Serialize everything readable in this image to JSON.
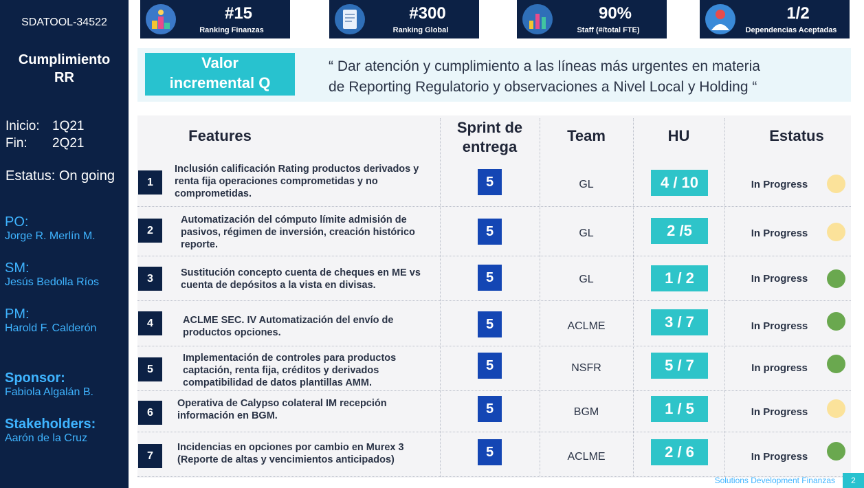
{
  "sidebar": {
    "id": "SDATOOL-34522",
    "title_line1": "Cumplimiento",
    "title_line2": "RR",
    "inicio_label": "Inicio:",
    "inicio_value": "1Q21",
    "fin_label": "Fin:",
    "fin_value": "2Q21",
    "estatus": "Estatus: On going",
    "po_label": "PO:",
    "po_name": "Jorge R. Merlín M.",
    "sm_label": "SM:",
    "sm_name": "Jesús Bedolla Ríos",
    "pm_label": "PM:",
    "pm_name": "Harold F. Calderón",
    "sponsor_label": "Sponsor:",
    "sponsor_name": "Fabiola Algalán B.",
    "stakeholders_label": "Stakeholders:",
    "stakeholders_name": "Aarón de la Cruz"
  },
  "kpis": [
    {
      "value": "#15",
      "label": "Ranking Finanzas",
      "icon": "podium-icon"
    },
    {
      "value": "#300",
      "label": "Ranking Global",
      "icon": "document-icon"
    },
    {
      "value": "90%",
      "label": "Staff (#/total FTE)",
      "icon": "bar-chart-icon"
    },
    {
      "value": "1/2",
      "label": "Dependencias Aceptadas",
      "icon": "person-icon"
    }
  ],
  "value_box": {
    "line1": "Valor",
    "line2": "incremental Q"
  },
  "quote": {
    "line1": "“ Dar atención y cumplimiento a las líneas más urgentes en materia",
    "line2": "de Reporting Regulatorio y observaciones a Nivel Local y Holding “"
  },
  "table": {
    "headers": {
      "features": "Features",
      "sprint_1": "Sprint de",
      "sprint_2": "entrega",
      "team": "Team",
      "hu": "HU",
      "estatus": "Estatus"
    },
    "rows": [
      {
        "n": "1",
        "feature": [
          "Inclusión calificación Rating productos derivados y",
          "renta fija operaciones comprometidas y no",
          "comprometidas."
        ],
        "sprint": "5",
        "team": "GL",
        "hu": "4 / 10",
        "status": "In Progress",
        "dot": "#fbe29a"
      },
      {
        "n": "2",
        "feature": [
          "Automatización del cómputo límite admisión de",
          "pasivos, régimen de inversión, creación histórico",
          "reporte."
        ],
        "sprint": "5",
        "team": "GL",
        "hu": "2 /5",
        "status": "In Progress",
        "dot": "#fbe29a"
      },
      {
        "n": "3",
        "feature": [
          "Sustitución concepto cuenta de cheques en ME vs",
          "cuenta de depósitos a la vista en divisas.",
          ""
        ],
        "sprint": "5",
        "team": "GL",
        "hu": "1 / 2",
        "status": "In Progress",
        "dot": "#6aa84f"
      },
      {
        "n": "4",
        "feature": [
          "ACLME SEC. IV Automatización del envío de",
          "productos opciones.",
          ""
        ],
        "sprint": "5",
        "team": "ACLME",
        "hu": "3 / 7",
        "status": "In Progress",
        "dot": "#6aa84f"
      },
      {
        "n": "5",
        "feature": [
          "Implementación de controles para productos",
          "captación, renta fija, créditos y derivados",
          "compatibilidad de datos plantillas AMM."
        ],
        "sprint": "5",
        "team": "NSFR",
        "hu": "5 / 7",
        "status": "In progress",
        "dot": "#6aa84f"
      },
      {
        "n": "6",
        "feature": [
          "Operativa de Calypso colateral IM recepción",
          "información en BGM.",
          ""
        ],
        "sprint": "5",
        "team": "BGM",
        "hu": "1 / 5",
        "status": "In Progress",
        "dot": "#fbe29a"
      },
      {
        "n": "7",
        "feature": [
          "Incidencias en opciones por cambio en Murex 3",
          "(Reporte de altas y vencimientos anticipados)",
          ""
        ],
        "sprint": "5",
        "team": "ACLME",
        "hu": "2 / 6",
        "status": "In Progress",
        "dot": "#6aa84f"
      }
    ]
  },
  "footer": {
    "text": "Solutions Development Finanzas",
    "page": "2"
  }
}
